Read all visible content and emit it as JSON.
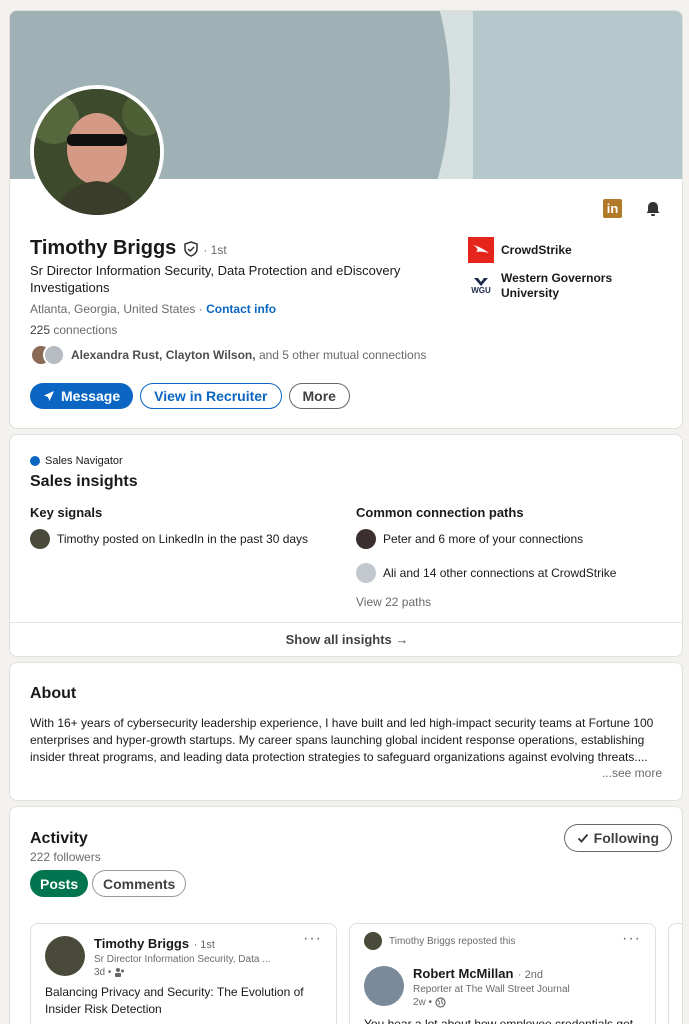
{
  "profile": {
    "name": "Timothy Briggs",
    "degree": "· 1st",
    "headline": "Sr Director Information Security, Data Protection and eDiscovery Investigations",
    "location": "Atlanta, Georgia, United States ·",
    "contact_info": "Contact info",
    "connections_count": "225",
    "connections_label": "connections",
    "mutual_names": "Alexandra Rust, Clayton Wilson,",
    "mutual_rest": "and 5 other mutual connections",
    "buttons": {
      "message": "Message",
      "view_in_recruiter": "View in Recruiter",
      "more": "More"
    },
    "orgs": [
      {
        "name": "CrowdStrike",
        "icon": "crowdstrike-logo",
        "color": "#e5241b"
      },
      {
        "name": "Western Governors University",
        "icon": "wgu-logo",
        "logo_text": "WGU"
      }
    ],
    "header_icons": [
      "linkedin-icon",
      "bell-icon"
    ]
  },
  "sales": {
    "brand": "Sales Navigator",
    "title": "Sales insights",
    "key_signals_title": "Key signals",
    "key_signal": "Timothy posted on LinkedIn in the past 30 days",
    "paths_title": "Common connection paths",
    "paths": [
      "Peter and 6 more of your connections",
      "Ali and 14 other connections at CrowdStrike"
    ],
    "view_paths": "View 22 paths",
    "show_all": "Show all insights →"
  },
  "about": {
    "title": "About",
    "text": "With 16+ years of cybersecurity leadership experience, I have built and led high-impact security teams at Fortune 100 enterprises and hyper-growth startups. My career spans launching global incident response operations, establishing insider threat programs, and leading data protection strategies to safeguard organizations against evolving threats....",
    "see_more": "...see more"
  },
  "activity": {
    "title": "Activity",
    "followers": "222 followers",
    "following": "Following",
    "tabs": [
      "Posts",
      "Comments"
    ],
    "posts": [
      {
        "author": "Timothy Briggs",
        "degree": "· 1st",
        "subtitle": "Sr Director Information Security, Data ...",
        "time": "3d •",
        "text": "Balancing Privacy and Security: The Evolution of Insider Risk Detection",
        "menu": "···"
      },
      {
        "repost_line": "Timothy Briggs reposted this",
        "author": "Robert McMillan",
        "degree": "· 2nd",
        "subtitle": "Reporter at The Wall Street Journal",
        "time": "2w •",
        "text": "You hear a lot about how employee credentials get",
        "menu": "···"
      }
    ]
  },
  "colors": {
    "accent": "#0a66c2",
    "green": "#01754f",
    "cover": "#a0b1b6"
  }
}
